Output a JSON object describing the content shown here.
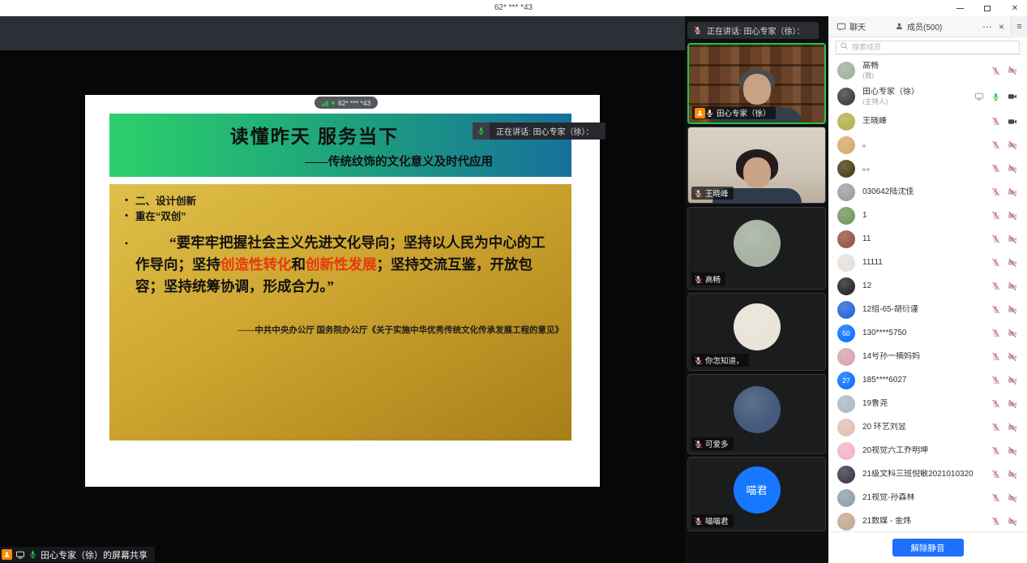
{
  "window": {
    "title": "62* *** *43",
    "controls": [
      "minimize",
      "restore",
      "close"
    ],
    "close_glyph": "✕"
  },
  "share_overlay": {
    "pill_text": "62* *** *43",
    "speaking_toast": "正在讲话: 田心专家（徐）：",
    "bottom_share_label": "田心专家（徐）的屏幕共享"
  },
  "slide": {
    "title": "读懂昨天 服务当下",
    "subtitle": "——传统纹饰的文化意义及时代应用",
    "bullets": [
      "二、设计创新",
      "重在“双创”"
    ],
    "quote_bullet": "•",
    "quote_parts": [
      {
        "text": "“要牢牢把握社会主义先进文化导向；坚持以人民为中心的工作导向；坚持",
        "red": false
      },
      {
        "text": "创造性转化",
        "red": true
      },
      {
        "text": "和",
        "red": false
      },
      {
        "text": "创新性发展",
        "red": true
      },
      {
        "text": "；坚持交流互鉴，开放包容；坚持统筹协调，形成合力。”",
        "red": false
      }
    ],
    "attribution": "——中共中央办公厅 国务院办公厅《关于实施中华优秀传统文化传承发展工程的意见》",
    "colors": {
      "banner_left": "#2bd06b",
      "banner_right": "#17709c",
      "gold_top": "#dfc04a",
      "gold_bottom": "#a87e18",
      "red_text": "#e8380d"
    }
  },
  "video_sidebar": {
    "speaking_banner": "正在讲话: 田心专家（徐）：",
    "tiles": [
      {
        "name": "田心专家（徐）",
        "kind": "video",
        "scene": "bookshelf",
        "active": true,
        "badges": [
          "share-person",
          "mic-white"
        ]
      },
      {
        "name": "王晓峰",
        "kind": "video",
        "scene": "room",
        "active": false,
        "badges": [
          "mic-muted-strong"
        ]
      },
      {
        "name": "高畅",
        "kind": "avatar",
        "avatar_bg": "#a7b2a3",
        "avatar_text": "",
        "active": false,
        "badges": [
          "mic-muted-strong"
        ]
      },
      {
        "name": "你怎知道，",
        "kind": "avatar",
        "avatar_bg": "#e9e3d8",
        "avatar_text": "",
        "active": false,
        "badges": [
          "mic-muted-strong"
        ]
      },
      {
        "name": "可爱多",
        "kind": "avatar",
        "avatar_bg": "#44597c",
        "avatar_text": "",
        "active": false,
        "badges": [
          "mic-muted-strong"
        ]
      },
      {
        "name": "喵喵君",
        "kind": "initials",
        "avatar_bg": "#1677ff",
        "avatar_text": "喵君",
        "active": false,
        "badges": [
          "mic-muted-strong"
        ]
      }
    ]
  },
  "panel": {
    "tabs": [
      {
        "label": "聊天",
        "icon": "chat-icon"
      },
      {
        "label": "成员(500)",
        "icon": "member-icon"
      }
    ],
    "more_glyph": "⋯",
    "close_glyph": "×",
    "menu_glyph": "≡",
    "search_placeholder": "搜索成员",
    "members": [
      {
        "name": "高畅",
        "sub": "(我)",
        "avatar": {
          "bg": "#a7b2a3",
          "text": ""
        },
        "icons": [
          "mic-muted",
          "cam-off"
        ]
      },
      {
        "name": "田心专家（徐）",
        "sub": "(主持人)",
        "avatar": {
          "bg": "#46464a",
          "text": ""
        },
        "icons": [
          "screen-gray",
          "mic-green",
          "cam-on"
        ]
      },
      {
        "name": "王晓峰",
        "sub": "",
        "avatar": {
          "bg": "#b9b356",
          "text": ""
        },
        "icons": [
          "mic-muted",
          "cam-on"
        ]
      },
      {
        "name": "。",
        "sub": "",
        "avatar": {
          "bg": "#d9ad72",
          "text": ""
        },
        "icons": [
          "mic-muted",
          "cam-off"
        ]
      },
      {
        "name": "。。",
        "sub": "",
        "avatar": {
          "bg": "#554422",
          "text": ""
        },
        "icons": [
          "mic-muted",
          "cam-off"
        ]
      },
      {
        "name": "030642陆沈佳",
        "sub": "",
        "avatar": {
          "bg": "#9fa3a7",
          "text": ""
        },
        "icons": [
          "mic-muted",
          "cam-off"
        ]
      },
      {
        "name": "1",
        "sub": "",
        "avatar": {
          "bg": "#7a9a66",
          "text": ""
        },
        "icons": [
          "mic-muted",
          "cam-off"
        ]
      },
      {
        "name": "11",
        "sub": "",
        "avatar": {
          "bg": "#9c5a4a",
          "text": ""
        },
        "icons": [
          "mic-muted",
          "cam-off"
        ]
      },
      {
        "name": "11111",
        "sub": "",
        "avatar": {
          "bg": "#e7e2dc",
          "text": ""
        },
        "icons": [
          "mic-muted",
          "cam-off"
        ]
      },
      {
        "name": "12",
        "sub": "",
        "avatar": {
          "bg": "#2e2e30",
          "text": ""
        },
        "icons": [
          "mic-muted",
          "cam-off"
        ]
      },
      {
        "name": "12组-65-胡衍谨",
        "sub": "",
        "avatar": {
          "bg": "#2f6bd8",
          "text": ""
        },
        "icons": [
          "mic-muted",
          "cam-off"
        ]
      },
      {
        "name": "130****5750",
        "sub": "",
        "avatar": {
          "bg": "#1677ff",
          "text": "50"
        },
        "icons": [
          "mic-muted",
          "cam-off"
        ]
      },
      {
        "name": "14号孙一楠妈妈",
        "sub": "",
        "avatar": {
          "bg": "#d8a8b0",
          "text": ""
        },
        "icons": [
          "mic-muted",
          "cam-off"
        ]
      },
      {
        "name": "185****6027",
        "sub": "",
        "avatar": {
          "bg": "#1677ff",
          "text": "27"
        },
        "icons": [
          "mic-muted",
          "cam-off"
        ]
      },
      {
        "name": "19鲁尧",
        "sub": "",
        "avatar": {
          "bg": "#aebdc9",
          "text": ""
        },
        "icons": [
          "mic-muted",
          "cam-off"
        ]
      },
      {
        "name": "20 环艺刘昱",
        "sub": "",
        "avatar": {
          "bg": "#e3c3b4",
          "text": ""
        },
        "icons": [
          "mic-muted",
          "cam-off"
        ]
      },
      {
        "name": "20视觉六工乔明坤",
        "sub": "",
        "avatar": {
          "bg": "#f2b7c6",
          "text": ""
        },
        "icons": [
          "mic-muted",
          "cam-off"
        ]
      },
      {
        "name": "21级文科三班倪敏2021010320",
        "sub": "",
        "avatar": {
          "bg": "#474052",
          "text": ""
        },
        "icons": [
          "mic-muted",
          "cam-off"
        ]
      },
      {
        "name": "21视觉-孙森林",
        "sub": "",
        "avatar": {
          "bg": "#93a3ad",
          "text": ""
        },
        "icons": [
          "mic-muted",
          "cam-off"
        ]
      },
      {
        "name": "21数媒 - 金炜",
        "sub": "",
        "avatar": {
          "bg": "#c4ad93",
          "text": ""
        },
        "icons": [
          "mic-muted",
          "cam-off"
        ]
      }
    ],
    "footer_button": "解除静音",
    "colors": {
      "accent_blue": "#1f6fff",
      "mic_green": "#23c343",
      "danger_red": "#f54a45",
      "share_orange": "#ff8a00"
    }
  }
}
